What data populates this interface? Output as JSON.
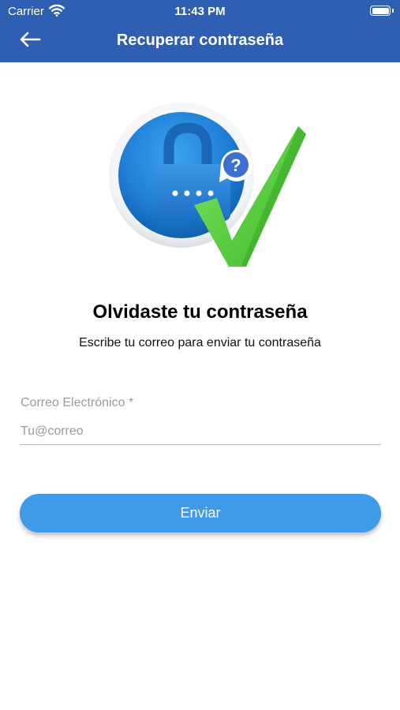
{
  "status_bar": {
    "carrier": "Carrier",
    "time": "11:43 PM",
    "wifi_icon": "wifi-icon",
    "battery_icon": "battery-icon"
  },
  "nav": {
    "back_icon": "arrow-left-icon",
    "title": "Recuperar contraseña"
  },
  "illustration": {
    "icon": "padlock-password-checkmark-illustration",
    "question_mark": "?"
  },
  "content": {
    "title": "Olvidaste tu contraseña",
    "subtitle": "Escribe tu correo para enviar tu contraseña"
  },
  "form": {
    "email_label": "Correo Electrónico *",
    "email_placeholder": "Tu@correo",
    "email_value": "",
    "submit_label": "Enviar"
  },
  "colors": {
    "header": "#2f5fb2",
    "button": "#3f9be8",
    "check": "#5bd33f",
    "circle": "#1f7fd6"
  }
}
